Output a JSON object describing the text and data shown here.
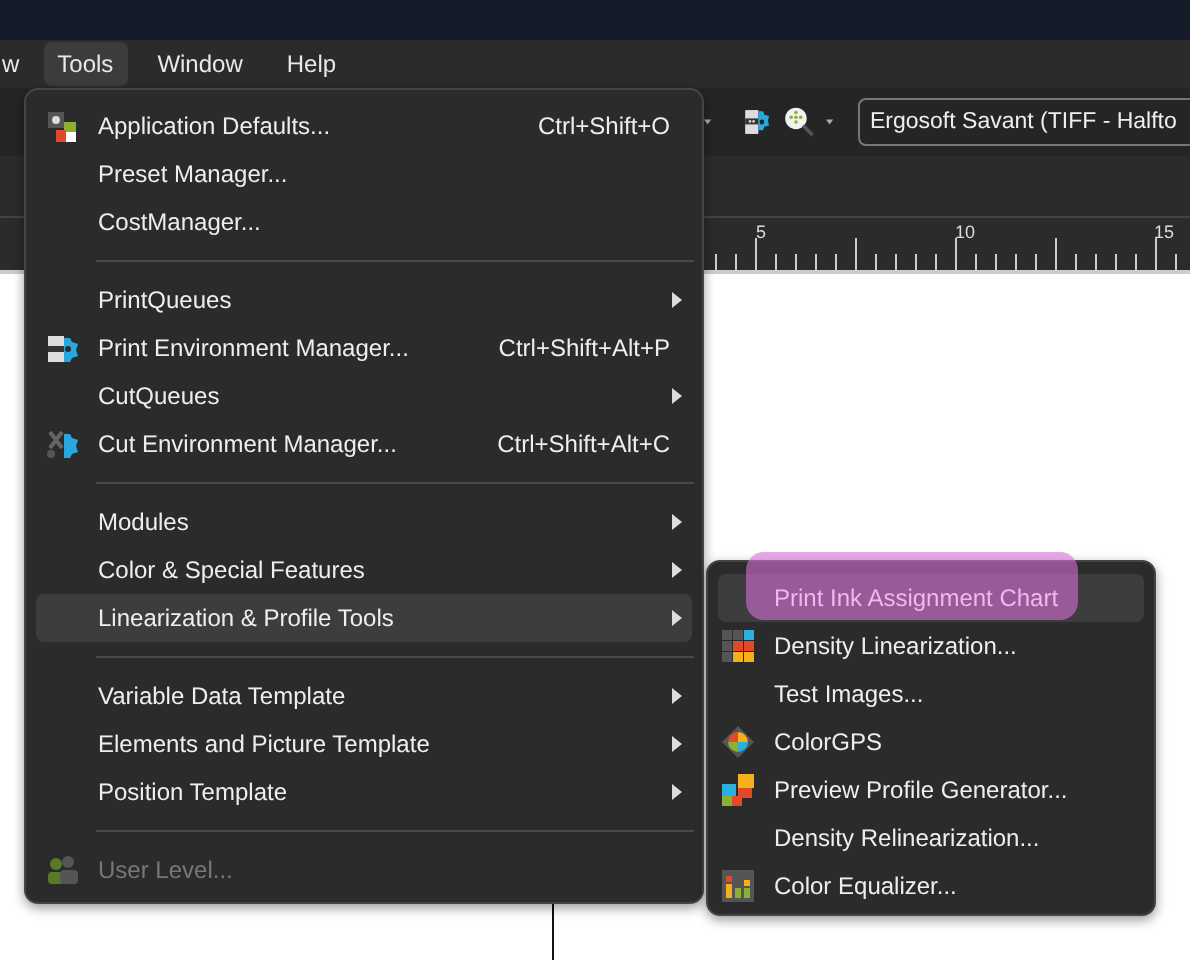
{
  "menubar": [
    {
      "label": "w",
      "selected": false
    },
    {
      "label": "Tools",
      "selected": true
    },
    {
      "label": "Window",
      "selected": false
    },
    {
      "label": "Help",
      "selected": false
    }
  ],
  "toolbar": {
    "preset_combo": {
      "value": "Ergosoft Savant (TIFF - Halfto"
    }
  },
  "ruler": {
    "labels": [
      "5",
      "10",
      "15"
    ]
  },
  "tools_menu": {
    "items": [
      {
        "kind": "item",
        "label": "Application Defaults...",
        "shortcut": "Ctrl+Shift+O",
        "submenu": false,
        "selected": false,
        "disabled": false
      },
      {
        "kind": "item",
        "label": "Preset Manager...",
        "submenu": false,
        "selected": false,
        "disabled": false
      },
      {
        "kind": "item",
        "label": "CostManager...",
        "submenu": false,
        "selected": false,
        "disabled": false
      },
      {
        "kind": "separator"
      },
      {
        "kind": "item",
        "label": "PrintQueues",
        "submenu": true,
        "selected": false,
        "disabled": false
      },
      {
        "kind": "item",
        "label": "Print Environment Manager...",
        "shortcut": "Ctrl+Shift+Alt+P",
        "submenu": false,
        "selected": false,
        "disabled": false
      },
      {
        "kind": "item",
        "label": "CutQueues",
        "submenu": true,
        "selected": false,
        "disabled": false
      },
      {
        "kind": "item",
        "label": "Cut Environment Manager...",
        "shortcut": "Ctrl+Shift+Alt+C",
        "submenu": false,
        "selected": false,
        "disabled": false
      },
      {
        "kind": "separator"
      },
      {
        "kind": "item",
        "label": "Modules",
        "submenu": true,
        "selected": false,
        "disabled": false
      },
      {
        "kind": "item",
        "label": "Color & Special Features",
        "submenu": true,
        "selected": false,
        "disabled": false
      },
      {
        "kind": "item",
        "label": "Linearization & Profile Tools",
        "submenu": true,
        "selected": true,
        "disabled": false
      },
      {
        "kind": "separator"
      },
      {
        "kind": "item",
        "label": "Variable Data Template",
        "submenu": true,
        "selected": false,
        "disabled": false
      },
      {
        "kind": "item",
        "label": "Elements and Picture Template",
        "submenu": true,
        "selected": false,
        "disabled": false
      },
      {
        "kind": "item",
        "label": "Position Template",
        "submenu": true,
        "selected": false,
        "disabled": false
      },
      {
        "kind": "separator"
      },
      {
        "kind": "item",
        "label": "User Level...",
        "submenu": false,
        "selected": false,
        "disabled": true
      }
    ]
  },
  "profile_submenu": {
    "items": [
      {
        "label": "Print Ink Assignment Chart",
        "selected": true,
        "marked": true
      },
      {
        "label": "Density Linearization...",
        "selected": false,
        "marked": false
      },
      {
        "label": "Test Images...",
        "selected": false,
        "marked": false
      },
      {
        "label": "ColorGPS",
        "selected": false,
        "marked": false
      },
      {
        "label": "Preview Profile Generator...",
        "selected": false,
        "marked": false
      },
      {
        "label": "Density Relinearization...",
        "selected": false,
        "marked": false
      },
      {
        "label": "Color Equalizer...",
        "selected": false,
        "marked": false
      }
    ]
  }
}
